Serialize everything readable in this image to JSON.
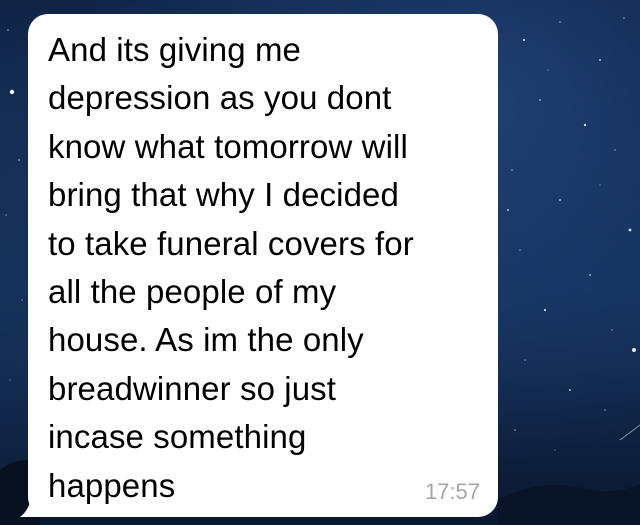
{
  "message": {
    "text": "And its giving me\ndepression as you dont\nknow what tomorrow will\nbring that why I decided\nto take funeral covers for\nall the people of my\nhouse. As im the only\nbreadwinner so just\nincase something\nhappens",
    "time": "17:57",
    "direction": "incoming"
  },
  "colors": {
    "bubble": "#ffffff",
    "text": "#000000",
    "timestamp": "#a6a6a6",
    "wallpaper": "#0d1f3f"
  }
}
